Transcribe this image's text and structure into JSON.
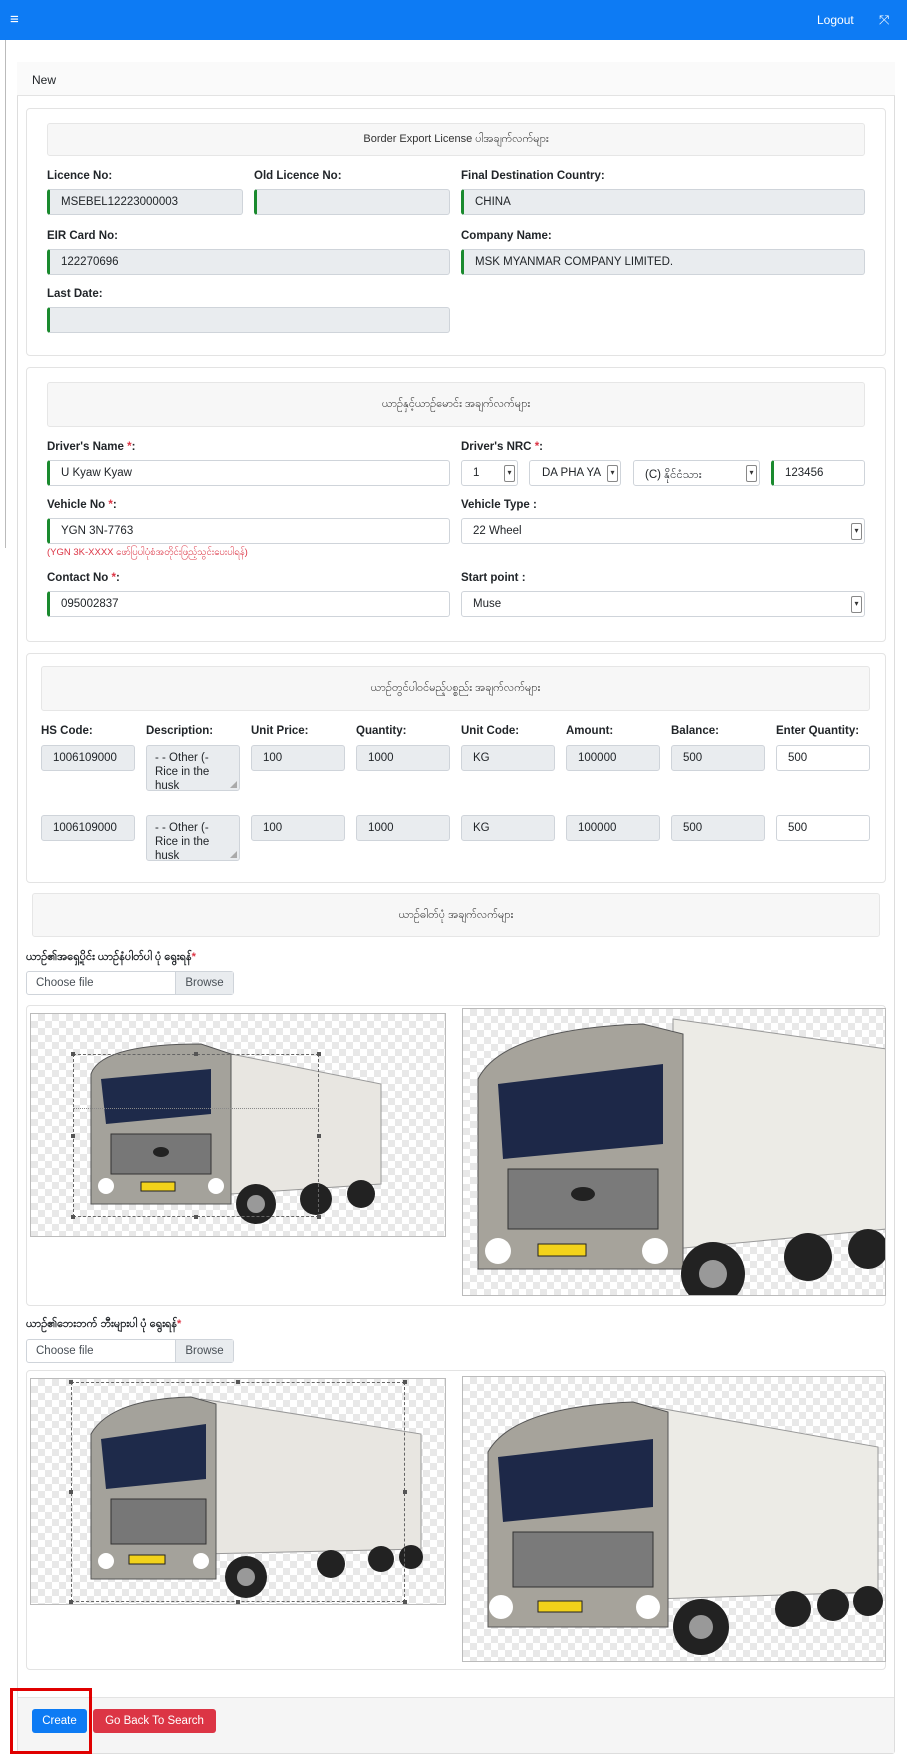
{
  "topbar": {
    "logout": "Logout"
  },
  "page": {
    "heading": "New"
  },
  "license": {
    "title": "Border Export License ပါအချက်လက်များ",
    "licence_no_label": "Licence No:",
    "licence_no": "MSEBEL12223000003",
    "old_licence_label": "Old Licence No:",
    "old_licence": "",
    "final_dest_label": "Final Destination Country:",
    "final_dest": "CHINA",
    "eir_label": "EIR Card No:",
    "eir": "122270696",
    "company_label": "Company Name:",
    "company": "MSK MYANMAR COMPANY LIMITED.",
    "last_date_label": "Last Date:",
    "last_date": ""
  },
  "driver": {
    "title": "ယာဉ်နှင့်ယာဉ်မောင်း အချက်လက်များ",
    "name_label": "Driver's Name ",
    "name": "U Kyaw Kyaw",
    "nrc_label": "Driver's NRC ",
    "nrc_state": "1",
    "nrc_town": "DA PHA YA",
    "nrc_type": "(C) နိုင်ငံသား",
    "nrc_number": "123456",
    "vehicle_no_label": "Vehicle No ",
    "vehicle_no": "YGN 3N-7763",
    "vehicle_hint": "(YGN 3K-XXXX ဖော်ပြပါပုံစံအတိုင်းဖြည့်သွင်းပေးပါရန်)",
    "vehicle_type_label": "Vehicle Type :",
    "vehicle_type": "22 Wheel",
    "contact_label": "Contact No ",
    "contact": "095002837",
    "start_label": "Start point :",
    "start": "Muse",
    "star": "*",
    "colon": ":"
  },
  "goods": {
    "title": "ယာဉ်တွင်ပါဝင်မည့်ပစ္စည်း အချက်လက်များ",
    "headers": [
      "HS Code:",
      "Description:",
      "Unit Price:",
      "Quantity:",
      "Unit Code:",
      "Amount:",
      "Balance:",
      "Enter Quantity:"
    ],
    "rows": [
      {
        "hs": "1006109000",
        "desc": "- - Other (- Rice in the husk",
        "price": "100",
        "qty": "1000",
        "unit": "KG",
        "amount": "100000",
        "balance": "500",
        "enter": "500"
      },
      {
        "hs": "1006109000",
        "desc": "- - Other (- Rice in the husk",
        "price": "100",
        "qty": "1000",
        "unit": "KG",
        "amount": "100000",
        "balance": "500",
        "enter": "500"
      }
    ]
  },
  "photos": {
    "title": "ယာဉ်ဓါတ်ပုံ အချက်လက်များ",
    "front_label": "ယာဉ်၏အရှေ့ပိုင်း ယာဉ်နံပါတ်ပါ ပုံ ရွေးရန်",
    "side_label": "ယာဉ်၏ဘေးဘက် ဘီးများပါ ပုံ ရွေးရန်",
    "star": "*",
    "choose": "Choose file",
    "browse": "Browse"
  },
  "actions": {
    "create": "Create",
    "back": "Go Back To Search"
  },
  "colors": {
    "primary": "#0d7bf4",
    "danger": "#dc3545",
    "valid": "#1a8a2e"
  }
}
